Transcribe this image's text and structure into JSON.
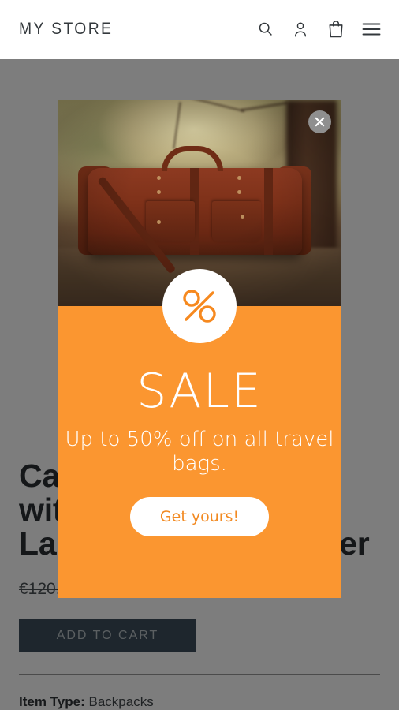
{
  "header": {
    "brand": "MY STORE",
    "icons": [
      {
        "name": "search-icon",
        "label": "Search"
      },
      {
        "name": "account-icon",
        "label": "Log in"
      },
      {
        "name": "cart-icon",
        "label": "Cart"
      },
      {
        "name": "menu-icon",
        "label": "Menu"
      }
    ]
  },
  "product": {
    "title": "Camping Backpack with Compartment Laptop and Rain Cover",
    "price_compare": "€120,",
    "add_to_cart_label": "ADD TO CART",
    "item_type_label": "Item Type:",
    "item_type_value": "Backpacks"
  },
  "promo": {
    "close_label": "×",
    "badge": "%",
    "heading": "SALE",
    "subtext": "Up to 50% off on all travel bags.",
    "cta_label": "Get yours!",
    "photo_alt": "brown leather duffel bag in forest"
  },
  "colors": {
    "promo_orange": "#FB9630",
    "cta_text": "#F28A22",
    "add_to_cart_bg": "#3D4F5C",
    "overlay": "rgba(0,0,0,0.51)",
    "header_text": "#33383C"
  }
}
